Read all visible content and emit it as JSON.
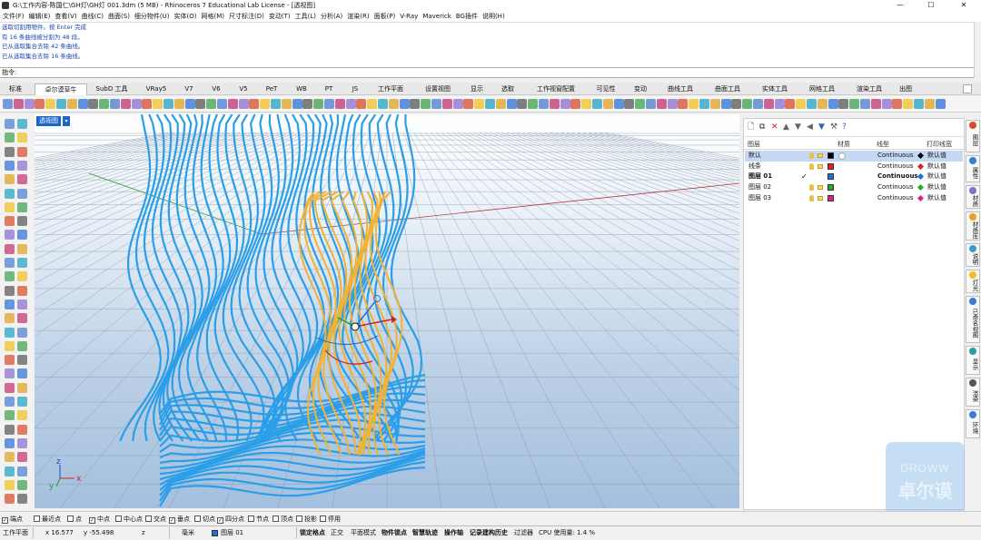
{
  "window": {
    "title": "G:\\工作内容-陈国仁\\GH灯\\GH灯 001.3dm (5 MB) - Rhinoceros 7 Educational Lab License - [透视图]",
    "controls": [
      "—",
      "☐",
      "✕"
    ]
  },
  "menu": [
    "文件(F)",
    "编辑(E)",
    "查看(V)",
    "曲线(C)",
    "曲面(S)",
    "细分物件(U)",
    "实体(O)",
    "网格(M)",
    "尺寸标注(D)",
    "变动(T)",
    "工具(L)",
    "分析(A)",
    "渲染(R)",
    "面板(P)",
    "V-Ray",
    "Maverick",
    "BG插件",
    "说明(H)"
  ],
  "command_history": [
    "选取切割用物件。按 Enter 完成",
    "有 16 条曲线被分割为 48 段。",
    "已从选取集合去除 42 条曲线。",
    "已从选取集合去除 16 条曲线。"
  ],
  "command_prompt": "指令:",
  "tabs": [
    "标准",
    "卓尔谟草牛",
    "SubD 工具",
    "VRay5",
    "V7",
    "V6",
    "V5",
    "PeT",
    "WB",
    "PT",
    "JS",
    "工作平面",
    "设置视图",
    "显示",
    "选取",
    "工作视窗配置",
    "可见性",
    "变动",
    "曲线工具",
    "曲面工具",
    "实体工具",
    "网格工具",
    "渲染工具",
    "出图"
  ],
  "active_tab": "卓尔谟草牛",
  "viewport": {
    "label": "透视图",
    "axis": {
      "x": "x",
      "y": "y",
      "z": "z"
    }
  },
  "layers": {
    "header": {
      "name": "图层",
      "material": "材质",
      "linetype": "线型",
      "print_width": "打印线宽"
    },
    "rows": [
      {
        "name": "默认",
        "swatch": "#000000",
        "linetype": "Continuous",
        "print_color": "#000000",
        "print_width": "默认值",
        "selected": true,
        "current": false
      },
      {
        "name": "线条",
        "swatch": "#e02020",
        "linetype": "Continuous",
        "print_color": "#e02020",
        "print_width": "默认值",
        "selected": false,
        "current": false
      },
      {
        "name": "图层 01",
        "swatch": "#1d6fe0",
        "linetype": "Continuous",
        "print_color": "#1d6fe0",
        "print_width": "默认值",
        "selected": false,
        "current": true
      },
      {
        "name": "图层 02",
        "swatch": "#22b022",
        "linetype": "Continuous",
        "print_color": "#22b022",
        "print_width": "默认值",
        "selected": false,
        "current": false
      },
      {
        "name": "图层 03",
        "swatch": "#e0208a",
        "linetype": "Continuous",
        "print_color": "#e0208a",
        "print_width": "默认值",
        "selected": false,
        "current": false
      }
    ]
  },
  "right_tabs": [
    {
      "label": "图层",
      "color": "#d84a2a"
    },
    {
      "label": "属性",
      "color": "#3a7bd5"
    },
    {
      "label": "材质",
      "color": "#8a6cd0"
    },
    {
      "label": "材质库",
      "color": "#f0a020"
    },
    {
      "label": "说明",
      "color": "#3a9ad5"
    },
    {
      "label": "灯光",
      "color": "#f0c020"
    },
    {
      "label": "已命名视图",
      "color": "#3a7bd5"
    },
    {
      "label": "显示",
      "color": "#20a0a0"
    },
    {
      "label": "渲染",
      "color": "#555555"
    },
    {
      "label": "环境",
      "color": "#3a7bd5"
    }
  ],
  "watermark": {
    "line1": "DROWW",
    "line2": "卓尔谟"
  },
  "osnap": [
    {
      "label": "端点",
      "checked": true
    },
    {
      "label": "最近点",
      "checked": false
    },
    {
      "label": "点",
      "checked": false
    },
    {
      "label": "中点",
      "checked": true
    },
    {
      "label": "中心点",
      "checked": false
    },
    {
      "label": "交点",
      "checked": false
    },
    {
      "label": "垂点",
      "checked": true
    },
    {
      "label": "切点",
      "checked": false
    },
    {
      "label": "四分点",
      "checked": true
    },
    {
      "label": "节点",
      "checked": false
    },
    {
      "label": "顶点",
      "checked": false
    },
    {
      "label": "投影",
      "checked": false
    },
    {
      "label": "停用",
      "checked": false
    }
  ],
  "status": {
    "cplane": "工作平面",
    "x": "x 16.577",
    "y": "y -55.498",
    "z": "z",
    "units": "毫米",
    "layer": "图层 01",
    "layer_color": "#1d6fe0",
    "toggles": [
      "锁定格点",
      "正交",
      "平面模式",
      "物件锁点",
      "智慧轨迹",
      "操作轴",
      "记录建构历史",
      "过滤器"
    ],
    "cpu": "CPU 使用量: 1.4 %"
  }
}
